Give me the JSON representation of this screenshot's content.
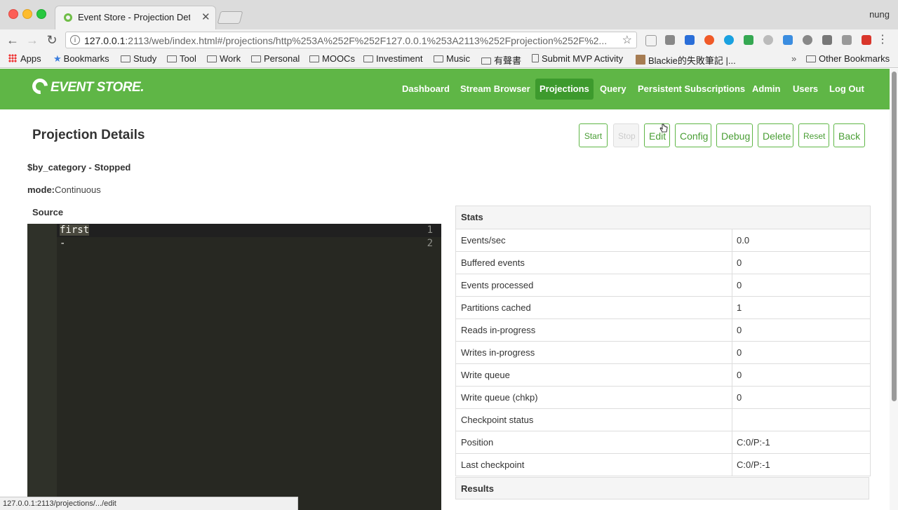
{
  "browser": {
    "tab_title": "Event Store - Projection Detail",
    "tab_close": "✕",
    "profile": "nung",
    "url_host": "127.0.0.1",
    "url_rest": ":2113/web/index.html#/projections/http%253A%252F%252F127.0.0.1%253A2113%252Fprojection%252F%2...",
    "status_url": "127.0.0.1:2113/projections/.../edit"
  },
  "bookmarks": [
    "Apps",
    "Bookmarks",
    "Study",
    "Tool",
    "Work",
    "Personal",
    "MOOCs",
    "Investiment",
    "Music",
    "有聲書",
    "Submit MVP Activity",
    "Blackie的失敗筆記 |...",
    "»",
    "Other Bookmarks"
  ],
  "app": {
    "logo": "EVENT STORE.",
    "nav": [
      "Dashboard",
      "Stream Browser",
      "Projections",
      "Query",
      "Persistent Subscriptions",
      "Admin",
      "Users",
      "Log Out"
    ],
    "active_nav": "Projections"
  },
  "page": {
    "title": "Projection Details",
    "buttons": [
      "Start",
      "Stop",
      "Edit",
      "Config",
      "Debug",
      "Delete",
      "Reset",
      "Back"
    ],
    "status": "$by_category - Stopped",
    "mode_label": "mode:",
    "mode_value": "Continuous",
    "source_label": "Source",
    "source_lines": [
      {
        "no": "1",
        "text": "first"
      },
      {
        "no": "2",
        "text": "-"
      }
    ],
    "stats_title": "Stats",
    "stats": [
      {
        "k": "Events/sec",
        "v": "0.0"
      },
      {
        "k": "Buffered events",
        "v": "0"
      },
      {
        "k": "Events processed",
        "v": "0"
      },
      {
        "k": "Partitions cached",
        "v": "1"
      },
      {
        "k": "Reads in-progress",
        "v": "0"
      },
      {
        "k": "Writes in-progress",
        "v": "0"
      },
      {
        "k": "Write queue",
        "v": "0"
      },
      {
        "k": "Write queue (chkp)",
        "v": "0"
      },
      {
        "k": "Checkpoint status",
        "v": ""
      },
      {
        "k": "Position",
        "v": "C:0/P:-1"
      },
      {
        "k": "Last checkpoint",
        "v": "C:0/P:-1"
      }
    ],
    "results_title": "Results"
  },
  "colors": {
    "header_green": "#5fb646",
    "active_nav": "#3d9a2d",
    "editor_bg": "#272822"
  }
}
